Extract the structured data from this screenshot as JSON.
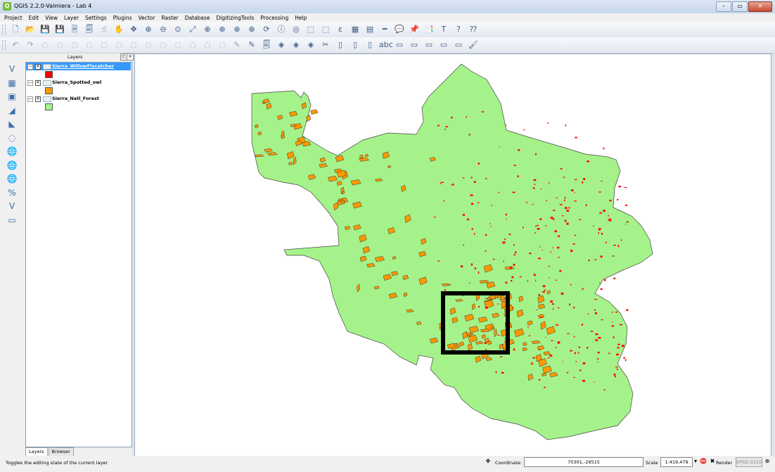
{
  "window": {
    "title": "QGIS 2.2.0-Valmiera - Lab 4",
    "app_icon_glyph": "Q",
    "buttons": [
      "–",
      "▭",
      "✕"
    ]
  },
  "menu": [
    "Project",
    "Edit",
    "View",
    "Layer",
    "Settings",
    "Plugins",
    "Vector",
    "Raster",
    "Database",
    "DigitizingTools",
    "Processing",
    "Help"
  ],
  "layers_panel": {
    "title": "Layers",
    "float_glyph": "◰",
    "close_glyph": "✕",
    "layers": [
      {
        "name": "Sierra_WillowFlycatcher",
        "visible": true,
        "selected": true,
        "expanded": true,
        "swatch": "#ff0000",
        "expand_glyph": "−",
        "check_glyph": "✕"
      },
      {
        "name": "Sierra_Spotted_owl",
        "visible": true,
        "selected": false,
        "expanded": true,
        "swatch": "#ff9900",
        "expand_glyph": "−",
        "check_glyph": "✕"
      },
      {
        "name": "Sierra_Natl_Forest",
        "visible": true,
        "selected": false,
        "expanded": true,
        "swatch": "#a5f28a",
        "expand_glyph": "−",
        "check_glyph": "✕"
      }
    ],
    "tabs": [
      "Layers",
      "Browser"
    ]
  },
  "status": {
    "message": "Toggles the editing state of the current layer",
    "coordinate_label": "Coordinate:",
    "coordinate_value": "70301,-29515",
    "scale_label": "Scale",
    "scale_value": "1:419,479",
    "dropdown_glyph": "▾",
    "render_label": "Render",
    "render_check_glyph": "✖",
    "crs": "EPSG:3310",
    "coord_icon_glyph": "✥",
    "stop_icon_glyph": "⛔",
    "log_icon_glyph": "⊕"
  },
  "map": {
    "forest_fill": "#a5f28a",
    "owl_fill": "#ff9900",
    "flycatcher_fill": "#ff0000",
    "highlight_box_color": "#000000"
  },
  "icons": {
    "toolbar1": [
      "new-project-icon",
      "open-project-icon",
      "save-icon",
      "save-as-icon",
      "new-print-composer-icon",
      "composer-manager-icon",
      "touch-zoom-icon",
      "pan-icon",
      "pan-to-selection-icon",
      "zoom-in-icon",
      "zoom-out-icon",
      "zoom-actual-icon",
      "zoom-full-icon",
      "zoom-to-selection-icon",
      "zoom-to-layer-icon",
      "zoom-last-icon",
      "zoom-next-icon",
      "refresh-icon",
      "identify-icon",
      "measure-icon",
      "select-icon",
      "deselect-icon",
      "expression-select-icon",
      "attribute-table-icon",
      "field-calculator-icon",
      "measure-line-icon",
      "map-tips-icon",
      "new-bookmark-icon",
      "show-bookmarks-icon",
      "text-annotation-icon",
      "help-icon",
      "whats-this-icon"
    ],
    "toolbar2": [
      "undo-icon",
      "redo-icon",
      "add-ring-icon",
      "add-part-icon",
      "fill-ring-icon",
      "delete-ring-icon",
      "delete-part-icon",
      "reshape-icon",
      "offset-curve-icon",
      "split-features-icon",
      "split-parts-icon",
      "merge-selected-icon",
      "merge-attributes-icon",
      "rotate-point-icon",
      "simplify-icon",
      "digitize-icon",
      "edit-pencil-icon",
      "save-edits-icon",
      "add-feature-icon",
      "move-feature-icon",
      "node-tool-icon",
      "delete-selected-icon",
      "cut-features-icon",
      "copy-features-icon",
      "paste-features-icon",
      "label-icon",
      "pin-labels-icon",
      "show-hide-labels-icon",
      "move-label-icon",
      "rotate-label-icon",
      "change-label-icon",
      "brush-icon"
    ],
    "side": [
      "add-vector-layer-icon",
      "add-raster-layer-icon",
      "add-postgis-layer-icon",
      "add-spatialite-layer-icon",
      "add-mssql-layer-icon",
      "add-oracle-layer-icon",
      "add-wms-layer-icon",
      "add-wcs-layer-icon",
      "add-wfs-layer-icon",
      "add-delimited-text-icon",
      "new-shapefile-icon",
      "remove-layer-icon"
    ]
  },
  "glyphs": {
    "toolbar1": [
      "🗋",
      "📂",
      "💾",
      "💾",
      "🗎",
      "🗐",
      "☝",
      "✋",
      "✥",
      "⊕",
      "⊖",
      "⊙",
      "⤢",
      "⊕",
      "⊕",
      "⊕",
      "⊕",
      "⟳",
      "ⓘ",
      "◎",
      "⬚",
      "⬚",
      "ε",
      "▦",
      "▤",
      "━",
      "💬",
      "📌",
      "📑",
      "T",
      "?",
      "⁇"
    ],
    "toolbar2": [
      "↶",
      "↷",
      "◌",
      "◌",
      "◌",
      "◌",
      "◌",
      "◌",
      "◌",
      "◌",
      "◌",
      "◌",
      "◌",
      "◌",
      "◌",
      "✎",
      "✎",
      "🗐",
      "◈",
      "◈",
      "◈",
      "✂",
      "▯",
      "▯",
      "▯",
      "abc",
      "▭",
      "▭",
      "▭",
      "▭",
      "▭",
      "🖌"
    ],
    "side": [
      "V",
      "▦",
      "▣",
      "◢",
      "◣",
      "◌",
      "🌐",
      "🌐",
      "🌐",
      "%",
      "V",
      "▭"
    ]
  }
}
